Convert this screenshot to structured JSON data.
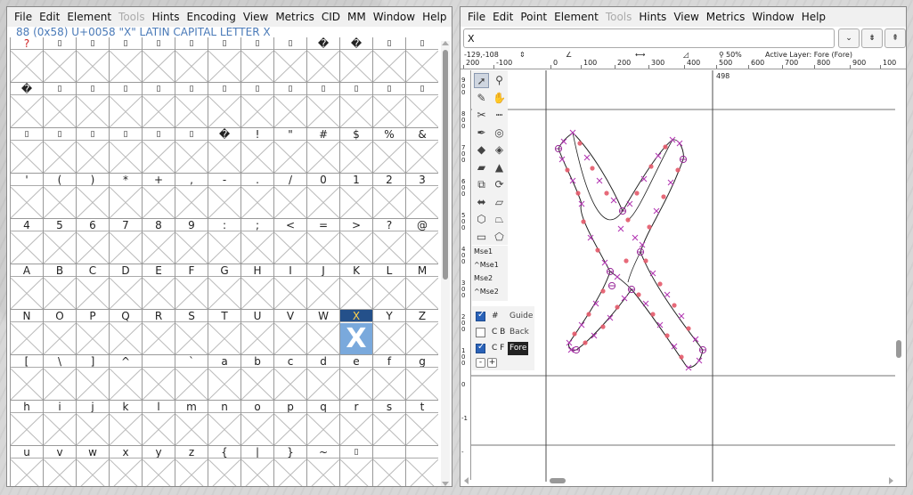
{
  "font_view": {
    "menu": [
      {
        "label": "File",
        "disabled": false
      },
      {
        "label": "Edit",
        "disabled": false
      },
      {
        "label": "Element",
        "disabled": false
      },
      {
        "label": "Tools",
        "disabled": true
      },
      {
        "label": "Hints",
        "disabled": false
      },
      {
        "label": "Encoding",
        "disabled": false
      },
      {
        "label": "View",
        "disabled": false
      },
      {
        "label": "Metrics",
        "disabled": false
      },
      {
        "label": "CID",
        "disabled": false
      },
      {
        "label": "MM",
        "disabled": false
      },
      {
        "label": "Window",
        "disabled": false
      },
      {
        "label": "Help",
        "disabled": false
      }
    ],
    "status": "88 (0x58) U+0058 \"X\" LATIN CAPITAL LETTER X",
    "selected_glyph": "X",
    "rows": [
      [
        "?",
        "▯",
        "▯",
        "▯",
        "▯",
        "▯",
        "▯",
        "▯",
        "▯",
        "�",
        "�",
        "▯",
        "▯"
      ],
      [
        "�",
        "▯",
        "▯",
        "▯",
        "▯",
        "▯",
        "▯",
        "▯",
        "▯",
        "▯",
        "▯",
        "▯",
        "▯"
      ],
      [
        "▯",
        "▯",
        "▯",
        "▯",
        "▯",
        "▯",
        "�",
        "!",
        "\"",
        "#",
        "$",
        "%",
        "&"
      ],
      [
        "'",
        "(",
        ")",
        "*",
        "+",
        ",",
        "-",
        ".",
        "/",
        "0",
        "1",
        "2",
        "3"
      ],
      [
        "4",
        "5",
        "6",
        "7",
        "8",
        "9",
        ":",
        ";",
        "<",
        "=",
        ">",
        "?",
        "@"
      ],
      [
        "A",
        "B",
        "C",
        "D",
        "E",
        "F",
        "G",
        "H",
        "I",
        "J",
        "K",
        "L",
        "M"
      ],
      [
        "N",
        "O",
        "P",
        "Q",
        "R",
        "S",
        "T",
        "U",
        "V",
        "W",
        "X",
        "Y",
        "Z"
      ],
      [
        "[",
        "\\",
        "]",
        "^",
        "_",
        "`",
        "a",
        "b",
        "c",
        "d",
        "e",
        "f",
        "g"
      ],
      [
        "h",
        "i",
        "j",
        "k",
        "l",
        "m",
        "n",
        "o",
        "p",
        "q",
        "r",
        "s",
        "t"
      ],
      [
        "u",
        "v",
        "w",
        "x",
        "y",
        "z",
        "{",
        "|",
        "}",
        "~",
        "▯",
        "",
        ""
      ]
    ]
  },
  "outline_view": {
    "menu": [
      {
        "label": "File",
        "disabled": false
      },
      {
        "label": "Edit",
        "disabled": false
      },
      {
        "label": "Point",
        "disabled": false
      },
      {
        "label": "Element",
        "disabled": false
      },
      {
        "label": "Tools",
        "disabled": true
      },
      {
        "label": "Hints",
        "disabled": false
      },
      {
        "label": "View",
        "disabled": false
      },
      {
        "label": "Metrics",
        "disabled": false
      },
      {
        "label": "Window",
        "disabled": false
      },
      {
        "label": "Help",
        "disabled": false
      }
    ],
    "glyph_input_value": "X",
    "dropdown_arrow": "⌄",
    "next_button": "⇟",
    "prev_button": "⇞",
    "coords": "-129,-108",
    "zoom": "50%",
    "active_layer": "Active Layer: Fore (Fore)",
    "width_label": "498",
    "hruler_labels": [
      "200",
      "-100",
      "0",
      "100",
      "200",
      "300",
      "400",
      "500",
      "600",
      "700",
      "800",
      "900",
      "100"
    ],
    "vruler_labels": [
      "900",
      "800",
      "700",
      "600",
      "500",
      "400",
      "300",
      "200",
      "100",
      "0",
      "-1",
      "-"
    ],
    "mouse": [
      "Mse1",
      "^Mse1",
      "Mse2",
      "^Mse2"
    ],
    "layers": [
      {
        "code": "#",
        "name": "Guide",
        "checked": true
      },
      {
        "code": "C B",
        "name": "Back",
        "checked": false
      },
      {
        "code": "C F",
        "name": "Fore",
        "checked": true
      }
    ],
    "layer_buttons": [
      "-",
      "+"
    ]
  }
}
